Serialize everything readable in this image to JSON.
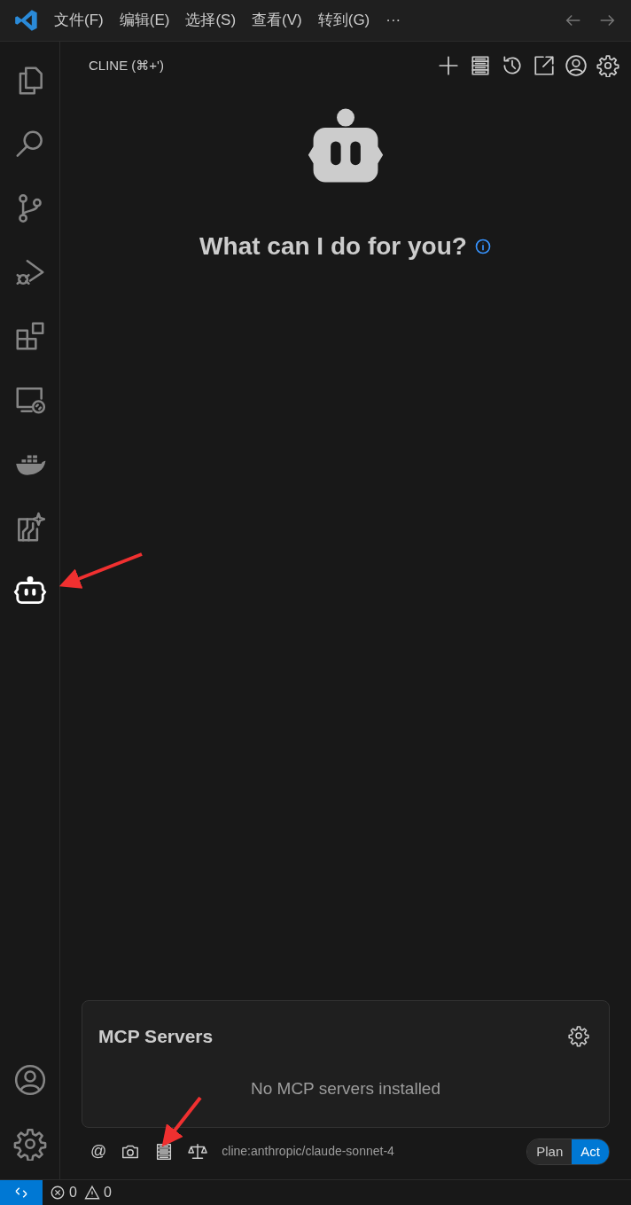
{
  "menu": [
    "文件(F)",
    "编辑(E)",
    "选择(S)",
    "查看(V)",
    "转到(G)",
    "···"
  ],
  "activity_bar": {
    "items": [
      {
        "kind": "explorer",
        "selected": false
      },
      {
        "kind": "search",
        "selected": false
      },
      {
        "kind": "git",
        "selected": false
      },
      {
        "kind": "debug",
        "selected": false
      },
      {
        "kind": "extensions",
        "selected": false
      },
      {
        "kind": "remote",
        "selected": false
      },
      {
        "kind": "docker",
        "selected": false
      },
      {
        "kind": "spark",
        "selected": false
      },
      {
        "kind": "robot",
        "selected": true
      }
    ],
    "bottom": [
      {
        "kind": "account"
      },
      {
        "kind": "gear"
      }
    ]
  },
  "panel": {
    "title": "CLINE (⌘+')",
    "heading": "What can I do for you?"
  },
  "mcp_popup": {
    "title": "MCP Servers",
    "message": "No MCP servers installed"
  },
  "input_toolbar": {
    "model": "cline:anthropic/claude-sonnet-4",
    "at": "@",
    "modes": [
      {
        "label": "Plan",
        "selected": false
      },
      {
        "label": "Act",
        "selected": true
      }
    ]
  },
  "status_bar": {
    "errors": "0",
    "warnings": "0"
  }
}
